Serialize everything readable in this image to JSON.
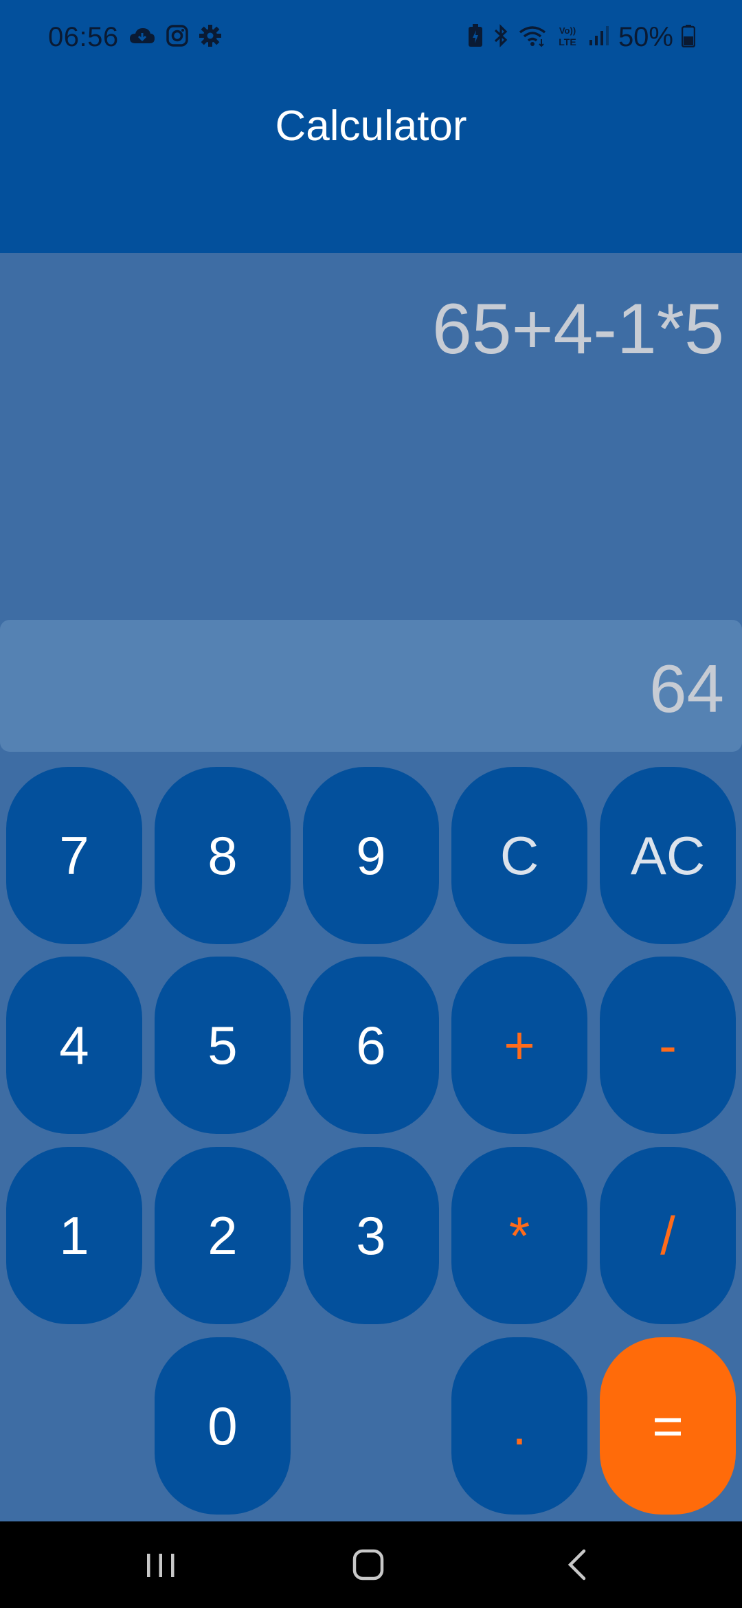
{
  "status_bar": {
    "time": "06:56",
    "battery": "50%",
    "left_icons": [
      "cloud-icon",
      "instagram-icon",
      "gear-icon"
    ],
    "right_icons": [
      "battery-saver-icon",
      "bluetooth-icon",
      "wifi-icon",
      "volte-icon",
      "signal-icon",
      "battery-icon"
    ],
    "volte_label_top": "Vo))",
    "volte_label_bottom": "LTE"
  },
  "app_bar": {
    "title": "Calculator"
  },
  "display": {
    "expression": "65+4-1*5",
    "result": "64"
  },
  "keypad": {
    "k7": "7",
    "k8": "8",
    "k9": "9",
    "kC": "C",
    "kAC": "AC",
    "k4": "4",
    "k5": "5",
    "k6": "6",
    "kplus": "+",
    "kminus": "-",
    "k1": "1",
    "k2": "2",
    "k3": "3",
    "kmul": "*",
    "kdiv": "/",
    "k0": "0",
    "kdot": ".",
    "keq": "="
  },
  "colors": {
    "primary": "#03509C",
    "background": "#3E6DA4",
    "result_bar": "#5582B3",
    "operator_text": "#FF6B1A",
    "equals_button": "#FF6B0A"
  },
  "nav_bar": {
    "buttons": [
      "recent-apps-icon",
      "home-icon",
      "back-icon"
    ]
  }
}
